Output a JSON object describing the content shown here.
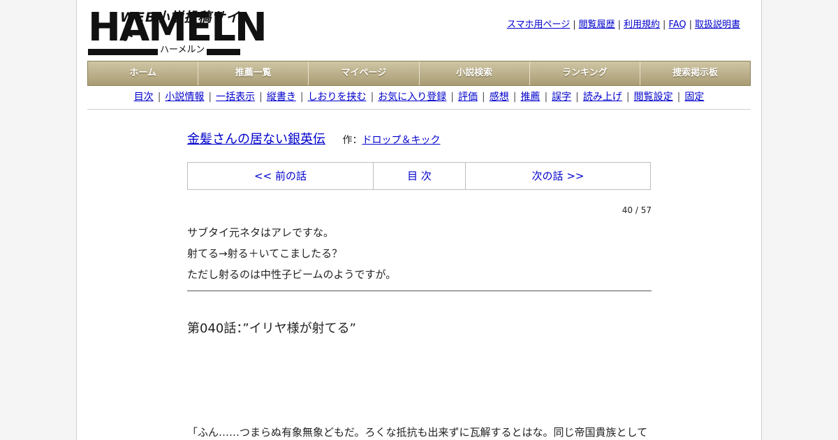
{
  "logo": {
    "tagline": "WEB小説投稿サイト",
    "name": "HAMELN",
    "kana": "ハーメルン"
  },
  "top_links": [
    "スマホ用ページ",
    "閲覧履歴",
    "利用規約",
    "FAQ",
    "取扱説明書"
  ],
  "main_nav": [
    "ホーム",
    "推薦一覧",
    "マイページ",
    "小説検索",
    "ランキング",
    "捜索掲示板"
  ],
  "sub_nav": [
    "目次",
    "小説情報",
    "一括表示",
    "縦書き",
    "しおりを挟む",
    "お気に入り登録",
    "評価",
    "感想",
    "推薦",
    "誤字",
    "読み上げ",
    "閲覧設定",
    "固定"
  ],
  "novel": {
    "title": "金髪さんの居ない銀英伝",
    "author_prefix": "作：",
    "author": "ドロップ＆キック"
  },
  "chapter_nav": {
    "prev": "<< 前の話",
    "toc": "目 次",
    "next": "次の話 >>"
  },
  "page_count": "40 / 57",
  "preface": [
    "サブタイ元ネタはアレですな。",
    "射てる→射る＋いてこましたる？",
    "ただし射るのは中性子ビームのようですが。"
  ],
  "chapter_title": "第040話：”イリヤ様が射てる”",
  "body_first_line": "「ふん……つまらぬ有象無象どもだ。ろくな抵抗も出来ずに瓦解するとはな。同じ帝国貴族として",
  "colors": {
    "nav_bg": "#a99c74",
    "link": "#0000cc"
  }
}
